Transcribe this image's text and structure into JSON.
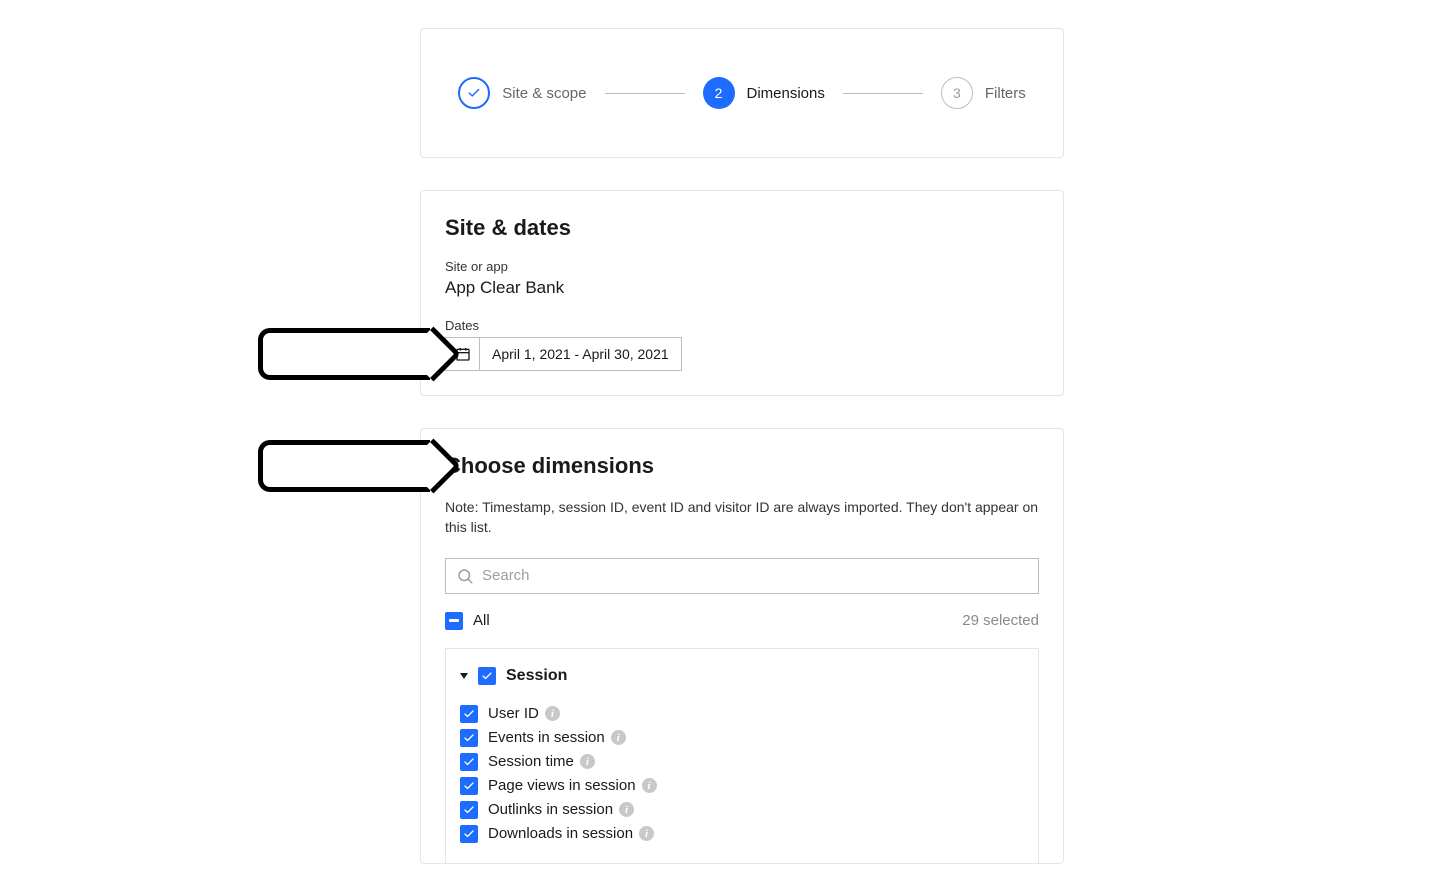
{
  "stepper": {
    "steps": [
      {
        "label": "Site & scope",
        "state": "done"
      },
      {
        "label": "Dimensions",
        "state": "active",
        "number": "2"
      },
      {
        "label": "Filters",
        "state": "inactive",
        "number": "3"
      }
    ]
  },
  "site_dates": {
    "title": "Site & dates",
    "site_label": "Site or app",
    "site_value": "App Clear Bank",
    "dates_label": "Dates",
    "date_range": "April 1, 2021 - April 30, 2021"
  },
  "dimensions": {
    "title": "Choose dimensions",
    "note": "Note: Timestamp, session ID, event ID and visitor ID are always imported. They don't appear on this list.",
    "search_placeholder": "Search",
    "all_label": "All",
    "selected_text": "29 selected",
    "group": {
      "name": "Session",
      "items": [
        {
          "label": "User ID",
          "checked": true,
          "info": true
        },
        {
          "label": "Events in session",
          "checked": true,
          "info": true
        },
        {
          "label": "Session time",
          "checked": true,
          "info": true
        },
        {
          "label": "Page views in session",
          "checked": true,
          "info": true
        },
        {
          "label": "Outlinks in session",
          "checked": true,
          "info": true
        },
        {
          "label": "Downloads in session",
          "checked": true,
          "info": true
        }
      ]
    }
  }
}
